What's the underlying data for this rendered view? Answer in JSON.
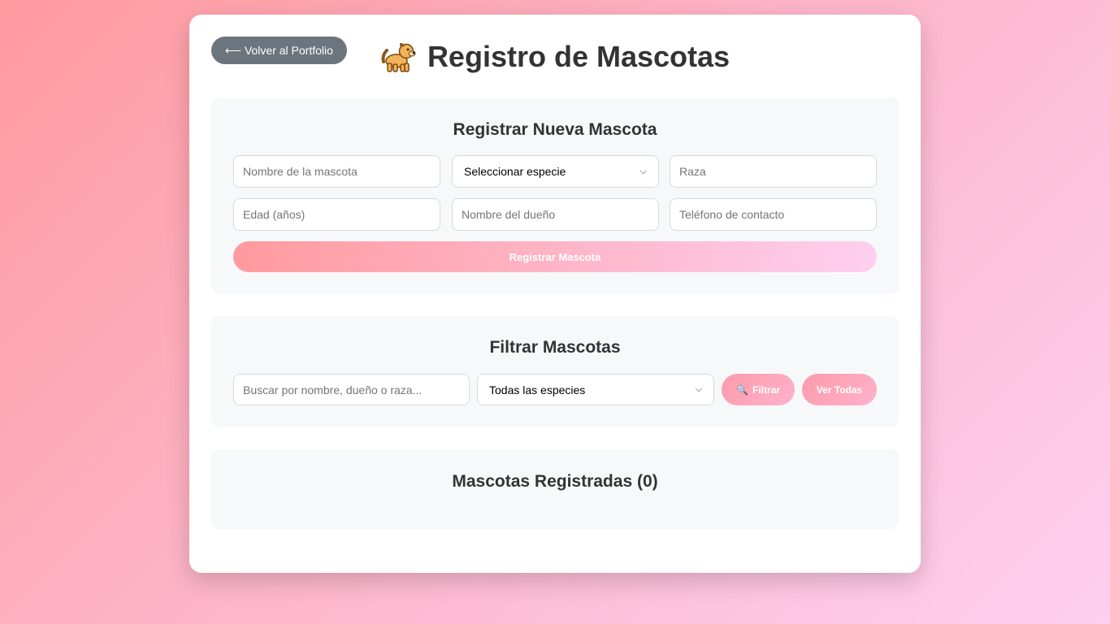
{
  "header": {
    "back_label": "⟵ Volver al Portfolio",
    "title": "Registro de Mascotas",
    "title_icon": "dog-icon"
  },
  "register": {
    "heading": "Registrar Nueva Mascota",
    "name_placeholder": "Nombre de la mascota",
    "species_selected": "Seleccionar especie",
    "breed_placeholder": "Raza",
    "age_placeholder": "Edad (años)",
    "owner_placeholder": "Nombre del dueño",
    "phone_placeholder": "Teléfono de contacto",
    "submit_label": "Registrar Mascota"
  },
  "filter": {
    "heading": "Filtrar Mascotas",
    "search_placeholder": "Buscar por nombre, dueño o raza...",
    "species_selected": "Todas las especies",
    "filter_label": "Filtrar",
    "filter_icon": "magnifier-icon",
    "all_label": "Ver Todas"
  },
  "list": {
    "heading": "Mascotas Registradas (0)"
  },
  "colors": {
    "accent_start": "#ff9a9e",
    "accent_end": "#fecfef",
    "back_button": "#6c757d"
  }
}
